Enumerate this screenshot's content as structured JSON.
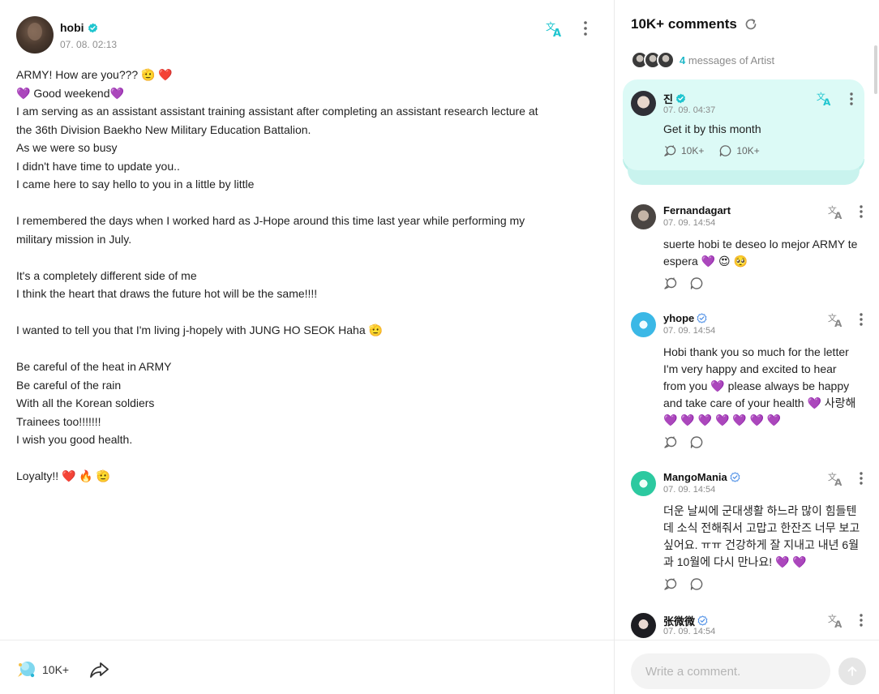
{
  "colors": {
    "accent": "#1fc5cf",
    "artist_card_bg": "#dcfaf6",
    "heart": "#8a4fd8",
    "muted": "#8a8a8a"
  },
  "post": {
    "author": "hobi",
    "date": "07. 08. 02:13",
    "lines": [
      "ARMY! How are you??? 🫡 ❤️",
      "💜 Good weekend💜",
      "I am serving as an assistant assistant training assistant after completing an assistant research lecture at",
      "the 36th Division Baekho New Military Education Battalion.",
      "As we were so busy",
      "I didn't have time to update you..",
      "I came here to say hello to you in a little by little",
      "",
      "I remembered the days when I worked hard as J-Hope around this time last year while performing my",
      "military mission in July.",
      "",
      "It's a completely different side of me",
      "I think the heart that draws the future hot will be the same!!!!",
      "",
      "I wanted to tell you that I'm living j-hopely with JUNG HO SEOK Haha 🫡",
      "",
      "Be careful of the heat in ARMY",
      "Be careful of the rain",
      "With all the Korean soldiers",
      "Trainees too!!!!!!!",
      "I wish you good health.",
      "",
      "Loyalty!! ❤️ 🔥 🫡"
    ],
    "like_count": "10K+",
    "icons": {
      "translate": "translate-icon",
      "more": "more-vertical-icon",
      "like": "like-icon",
      "share": "share-icon"
    }
  },
  "comments_panel": {
    "title": "10K+ comments",
    "artist_messages": {
      "count": "4",
      "label": "messages of Artist"
    },
    "artist_card": {
      "name": "진",
      "date": "07. 09. 04:37",
      "text": "Get it by this month",
      "likes": "10K+",
      "replies": "10K+"
    },
    "comments": [
      {
        "name": "Fernandagart",
        "date": "07. 09. 14:54",
        "verified": false,
        "text": "suerte hobi te deseo lo mejor ARMY te espera 💜 😍 🥺"
      },
      {
        "name": "yhope",
        "date": "07. 09. 14:54",
        "verified": true,
        "text": "Hobi thank you so much for the letter I'm very happy and excited to hear from you 💜 please always be happy and take care of your health 💜 사랑해 💜 💜 💜 💜 💜 💜 💜"
      },
      {
        "name": "MangoMania",
        "date": "07. 09. 14:54",
        "verified": true,
        "text": "더운 날씨에 군대생활 하느라 많이 힘들텐데 소식 전해줘서 고맙고 한잔즈 너무 보고싶어요. ㅠㅠ 건강하게 잘 지내고 내년 6월과 10월에 다시 만나요! 💜 💜"
      },
      {
        "name": "张微微",
        "date": "07. 09. 14:54",
        "verified": true,
        "text": ""
      }
    ],
    "input_placeholder": "Write a comment."
  }
}
